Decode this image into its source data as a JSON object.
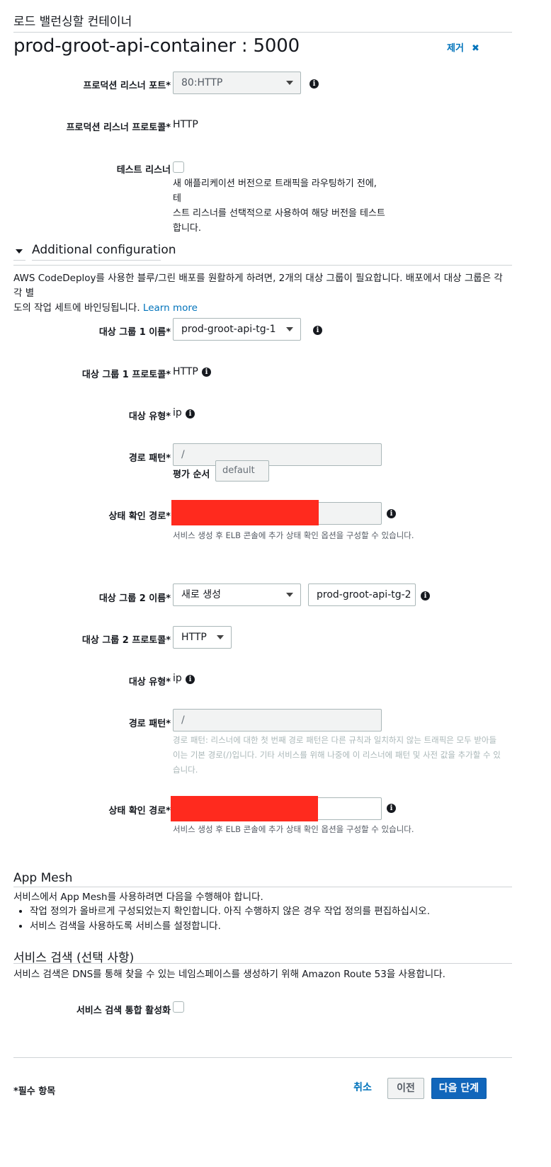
{
  "section": {
    "title": "로드 밸런싱할 컨테이너",
    "container_name": "prod-groot-api-container : 5000",
    "remove_label": "제거"
  },
  "listener": {
    "port_label": "프로덕션 리스너 포트*",
    "port_value": "80:HTTP",
    "protocol_label": "프로덕션 리스너 프로토콜*",
    "protocol_value": "HTTP",
    "test_label": "테스트 리스너",
    "test_help_lines": [
      "새 애플리케이션 버전으로 트래픽을 라우팅하기 전에, 테",
      "스트 리스너를 선택적으로 사용하여 해당 버전을 테스트",
      "합니다."
    ]
  },
  "additional": {
    "title": "Additional configuration",
    "desc_lines": [
      "AWS CodeDeploy를 사용한 블루/그린 배포를 원활하게 하려면, 2개의 대상 그룹이 필요합니다. 배포에서 대상 그룹은 각각 별",
      "도의 작업 세트에 바인딩됩니다."
    ],
    "learn_more": "Learn more"
  },
  "tg1": {
    "name_label": "대상 그룹 1 이름*",
    "name_value": "prod-groot-api-tg-1",
    "protocol_label": "대상 그룹 1 프로토콜*",
    "protocol_value": "HTTP",
    "type_label": "대상 유형*",
    "type_value": "ip",
    "path_label": "경로 패턴*",
    "path_value": "/",
    "eval_label": "평가 순서",
    "eval_value": "default",
    "health_label": "상태 확인 경로*",
    "health_help": "서비스 생성 후 ELB 콘솔에 추가 상태 확인 옵션을 구성할 수 있습니다."
  },
  "tg2": {
    "name_label": "대상 그룹 2 이름*",
    "name_select": "새로 생성",
    "name_value": "prod-groot-api-tg-2",
    "protocol_label": "대상 그룹 2 프로토콜*",
    "protocol_value": "HTTP",
    "type_label": "대상 유형*",
    "type_value": "ip",
    "path_label": "경로 패턴*",
    "path_value": "/",
    "path_help_lines": [
      "경로 패턴: 리스너에 대한 첫 번째 경로 패턴은 다른 규칙과 일치하지 않는 트래픽은 모두 받아들",
      "이는 기본 경로(/)입니다. 기타 서비스를 위해 나중에 이 리스너에 패턴 및 사전 값을 추가할 수 있",
      "습니다."
    ],
    "health_label": "상태 확인 경로*",
    "health_help": "서비스 생성 후 ELB 콘솔에 추가 상태 확인 옵션을 구성할 수 있습니다."
  },
  "app_mesh": {
    "title": "App Mesh",
    "desc": "서비스에서 App Mesh를 사용하려면 다음을 수행해야 합니다.",
    "bullets": [
      "작업 정의가 올바르게 구성되었는지 확인합니다. 아직 수행하지 않은 경우 작업 정의를 편집하십시오.",
      "서비스 검색을 사용하도록 서비스를 설정합니다."
    ]
  },
  "service_discovery": {
    "title": "서비스 검색 (선택 사항)",
    "desc": "서비스 검색은 DNS를 통해 찾을 수 있는 네임스페이스를 생성하기 위해 Amazon Route 53을 사용합니다.",
    "enable_label": "서비스 검색 통합 활성화"
  },
  "footer": {
    "required_note": "*필수 항목",
    "cancel": "취소",
    "previous": "이전",
    "next": "다음 단계"
  },
  "icons": {
    "info": "info-icon",
    "close": "close-icon",
    "caret_down": "caret-down-icon",
    "collapse_triangle": "caret-down-icon"
  },
  "colors": {
    "link": "#0073bb",
    "primary_button": "#1166bb",
    "redaction": "#ff2a1e"
  }
}
